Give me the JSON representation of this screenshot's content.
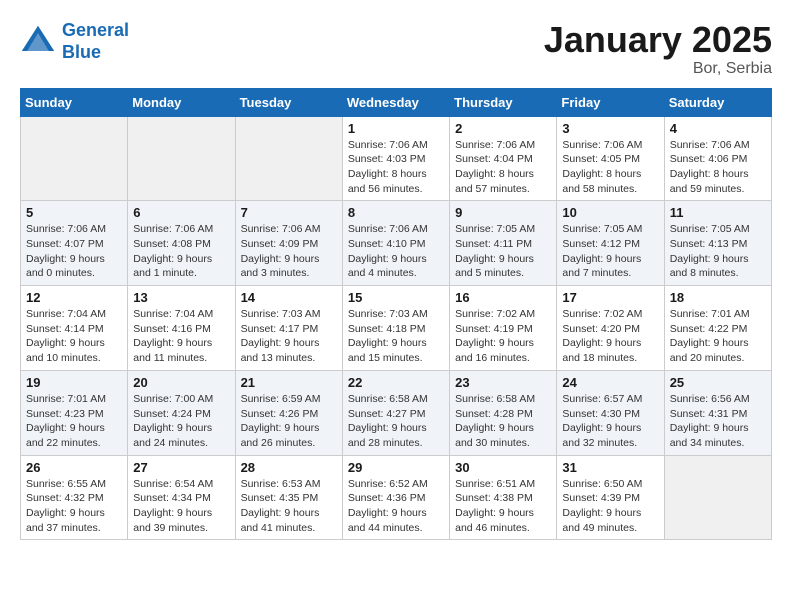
{
  "header": {
    "logo_general": "General",
    "logo_blue": "Blue",
    "month": "January 2025",
    "location": "Bor, Serbia"
  },
  "days_of_week": [
    "Sunday",
    "Monday",
    "Tuesday",
    "Wednesday",
    "Thursday",
    "Friday",
    "Saturday"
  ],
  "weeks": [
    [
      {
        "day": "",
        "info": ""
      },
      {
        "day": "",
        "info": ""
      },
      {
        "day": "",
        "info": ""
      },
      {
        "day": "1",
        "info": "Sunrise: 7:06 AM\nSunset: 4:03 PM\nDaylight: 8 hours and 56 minutes."
      },
      {
        "day": "2",
        "info": "Sunrise: 7:06 AM\nSunset: 4:04 PM\nDaylight: 8 hours and 57 minutes."
      },
      {
        "day": "3",
        "info": "Sunrise: 7:06 AM\nSunset: 4:05 PM\nDaylight: 8 hours and 58 minutes."
      },
      {
        "day": "4",
        "info": "Sunrise: 7:06 AM\nSunset: 4:06 PM\nDaylight: 8 hours and 59 minutes."
      }
    ],
    [
      {
        "day": "5",
        "info": "Sunrise: 7:06 AM\nSunset: 4:07 PM\nDaylight: 9 hours and 0 minutes."
      },
      {
        "day": "6",
        "info": "Sunrise: 7:06 AM\nSunset: 4:08 PM\nDaylight: 9 hours and 1 minute."
      },
      {
        "day": "7",
        "info": "Sunrise: 7:06 AM\nSunset: 4:09 PM\nDaylight: 9 hours and 3 minutes."
      },
      {
        "day": "8",
        "info": "Sunrise: 7:06 AM\nSunset: 4:10 PM\nDaylight: 9 hours and 4 minutes."
      },
      {
        "day": "9",
        "info": "Sunrise: 7:05 AM\nSunset: 4:11 PM\nDaylight: 9 hours and 5 minutes."
      },
      {
        "day": "10",
        "info": "Sunrise: 7:05 AM\nSunset: 4:12 PM\nDaylight: 9 hours and 7 minutes."
      },
      {
        "day": "11",
        "info": "Sunrise: 7:05 AM\nSunset: 4:13 PM\nDaylight: 9 hours and 8 minutes."
      }
    ],
    [
      {
        "day": "12",
        "info": "Sunrise: 7:04 AM\nSunset: 4:14 PM\nDaylight: 9 hours and 10 minutes."
      },
      {
        "day": "13",
        "info": "Sunrise: 7:04 AM\nSunset: 4:16 PM\nDaylight: 9 hours and 11 minutes."
      },
      {
        "day": "14",
        "info": "Sunrise: 7:03 AM\nSunset: 4:17 PM\nDaylight: 9 hours and 13 minutes."
      },
      {
        "day": "15",
        "info": "Sunrise: 7:03 AM\nSunset: 4:18 PM\nDaylight: 9 hours and 15 minutes."
      },
      {
        "day": "16",
        "info": "Sunrise: 7:02 AM\nSunset: 4:19 PM\nDaylight: 9 hours and 16 minutes."
      },
      {
        "day": "17",
        "info": "Sunrise: 7:02 AM\nSunset: 4:20 PM\nDaylight: 9 hours and 18 minutes."
      },
      {
        "day": "18",
        "info": "Sunrise: 7:01 AM\nSunset: 4:22 PM\nDaylight: 9 hours and 20 minutes."
      }
    ],
    [
      {
        "day": "19",
        "info": "Sunrise: 7:01 AM\nSunset: 4:23 PM\nDaylight: 9 hours and 22 minutes."
      },
      {
        "day": "20",
        "info": "Sunrise: 7:00 AM\nSunset: 4:24 PM\nDaylight: 9 hours and 24 minutes."
      },
      {
        "day": "21",
        "info": "Sunrise: 6:59 AM\nSunset: 4:26 PM\nDaylight: 9 hours and 26 minutes."
      },
      {
        "day": "22",
        "info": "Sunrise: 6:58 AM\nSunset: 4:27 PM\nDaylight: 9 hours and 28 minutes."
      },
      {
        "day": "23",
        "info": "Sunrise: 6:58 AM\nSunset: 4:28 PM\nDaylight: 9 hours and 30 minutes."
      },
      {
        "day": "24",
        "info": "Sunrise: 6:57 AM\nSunset: 4:30 PM\nDaylight: 9 hours and 32 minutes."
      },
      {
        "day": "25",
        "info": "Sunrise: 6:56 AM\nSunset: 4:31 PM\nDaylight: 9 hours and 34 minutes."
      }
    ],
    [
      {
        "day": "26",
        "info": "Sunrise: 6:55 AM\nSunset: 4:32 PM\nDaylight: 9 hours and 37 minutes."
      },
      {
        "day": "27",
        "info": "Sunrise: 6:54 AM\nSunset: 4:34 PM\nDaylight: 9 hours and 39 minutes."
      },
      {
        "day": "28",
        "info": "Sunrise: 6:53 AM\nSunset: 4:35 PM\nDaylight: 9 hours and 41 minutes."
      },
      {
        "day": "29",
        "info": "Sunrise: 6:52 AM\nSunset: 4:36 PM\nDaylight: 9 hours and 44 minutes."
      },
      {
        "day": "30",
        "info": "Sunrise: 6:51 AM\nSunset: 4:38 PM\nDaylight: 9 hours and 46 minutes."
      },
      {
        "day": "31",
        "info": "Sunrise: 6:50 AM\nSunset: 4:39 PM\nDaylight: 9 hours and 49 minutes."
      },
      {
        "day": "",
        "info": ""
      }
    ]
  ]
}
